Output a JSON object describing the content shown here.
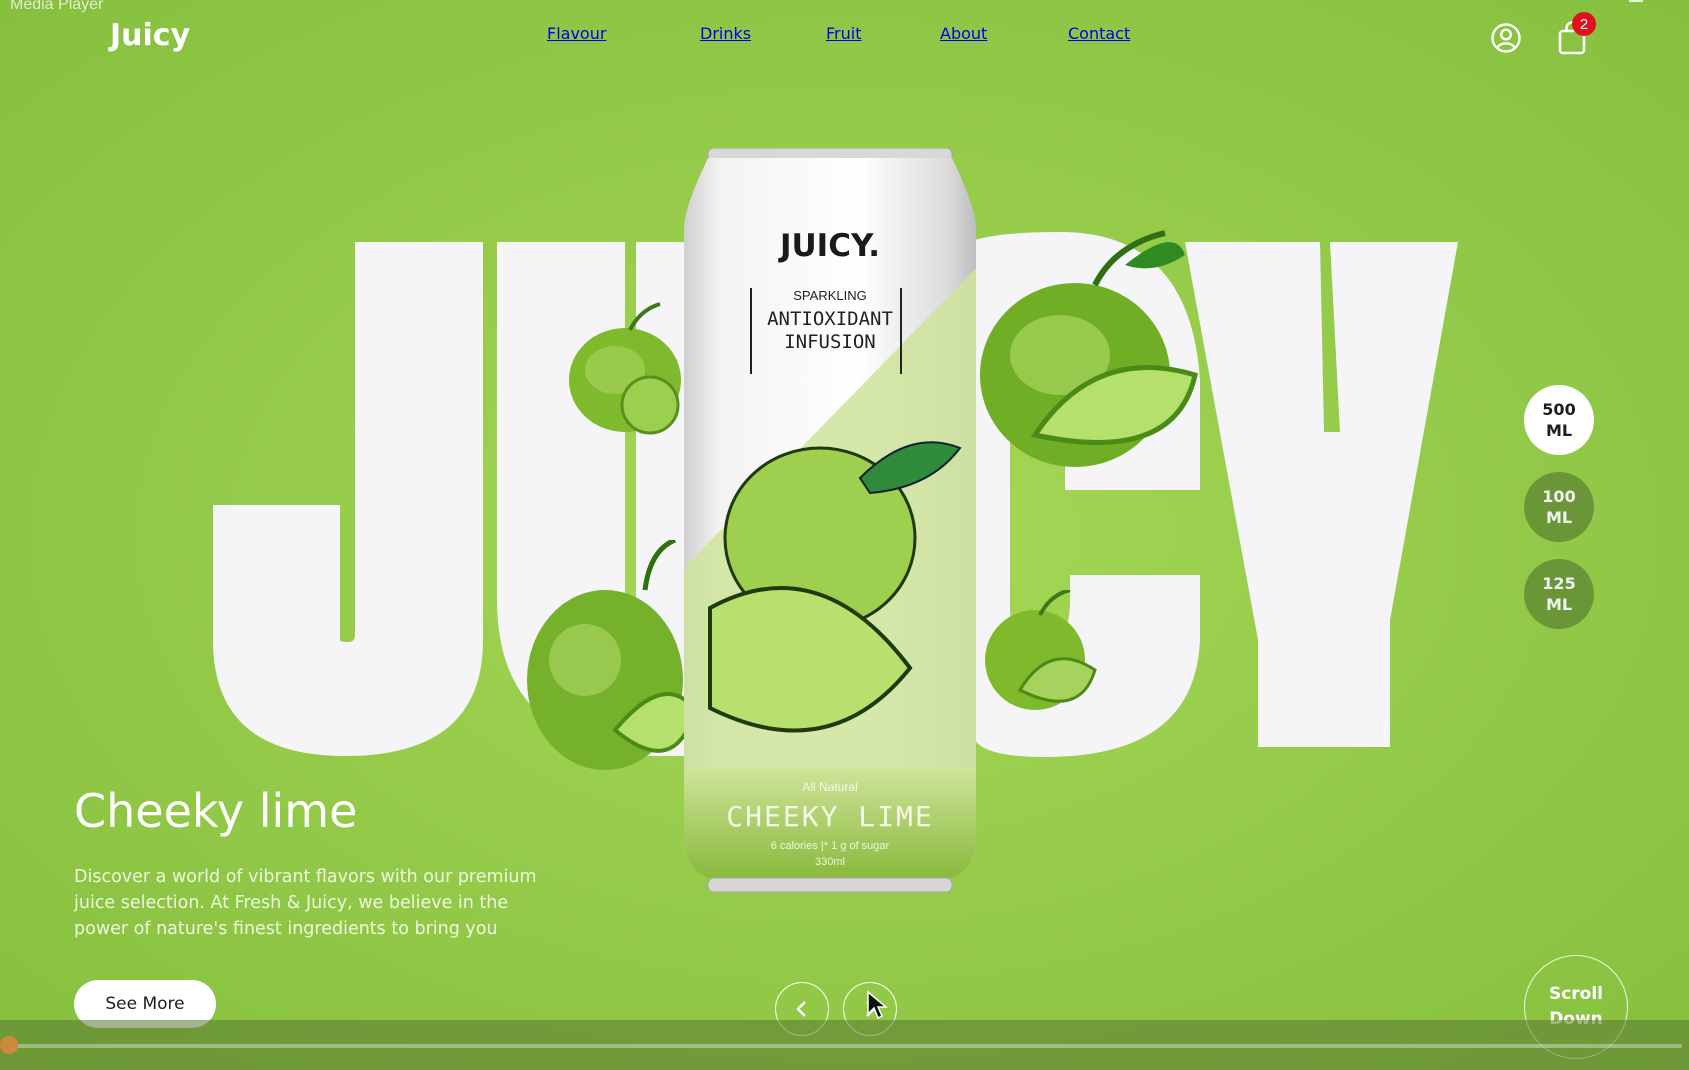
{
  "window": {
    "title": "Media Player"
  },
  "header": {
    "logo": "Juicy",
    "nav": [
      "Flavour",
      "Drinks",
      "Fruit",
      "About",
      "Contact"
    ],
    "cart_count": "2"
  },
  "hero": {
    "backdrop_letters": [
      "J",
      "U",
      "I",
      "C",
      "Y"
    ],
    "title": "Cheeky lime",
    "description": "Discover a world of vibrant flavors with our premium juice selection. At Fresh & Juicy, we believe in the power of nature's finest ingredients to bring you",
    "cta_label": "See More"
  },
  "can": {
    "brand": "JUICY.",
    "line1": "SPARKLING",
    "line2": "ANTIOXIDANT",
    "line3": "INFUSION",
    "tag": "All Natural",
    "flavor": "CHEEKY LIME",
    "facts": "6 calories  |* 1 g of sugar",
    "volume": "330ml"
  },
  "sizes": [
    {
      "line1": "500",
      "line2": "ML",
      "selected": true
    },
    {
      "line1": "100",
      "line2": "ML",
      "selected": false
    },
    {
      "line1": "125",
      "line2": "ML",
      "selected": false
    }
  ],
  "scroll": {
    "line1": "Scroll",
    "line2": "Down"
  },
  "player": {
    "progress": 0.0
  },
  "colors": {
    "background": "#97cc4b",
    "accent_dark": "#6b9638",
    "badge": "#e0101e",
    "letters": "#f5f5f7"
  },
  "icons": [
    "user-icon",
    "shopping-bag-icon",
    "chevron-left-icon",
    "chevron-right-icon",
    "mouse-cursor-icon"
  ]
}
